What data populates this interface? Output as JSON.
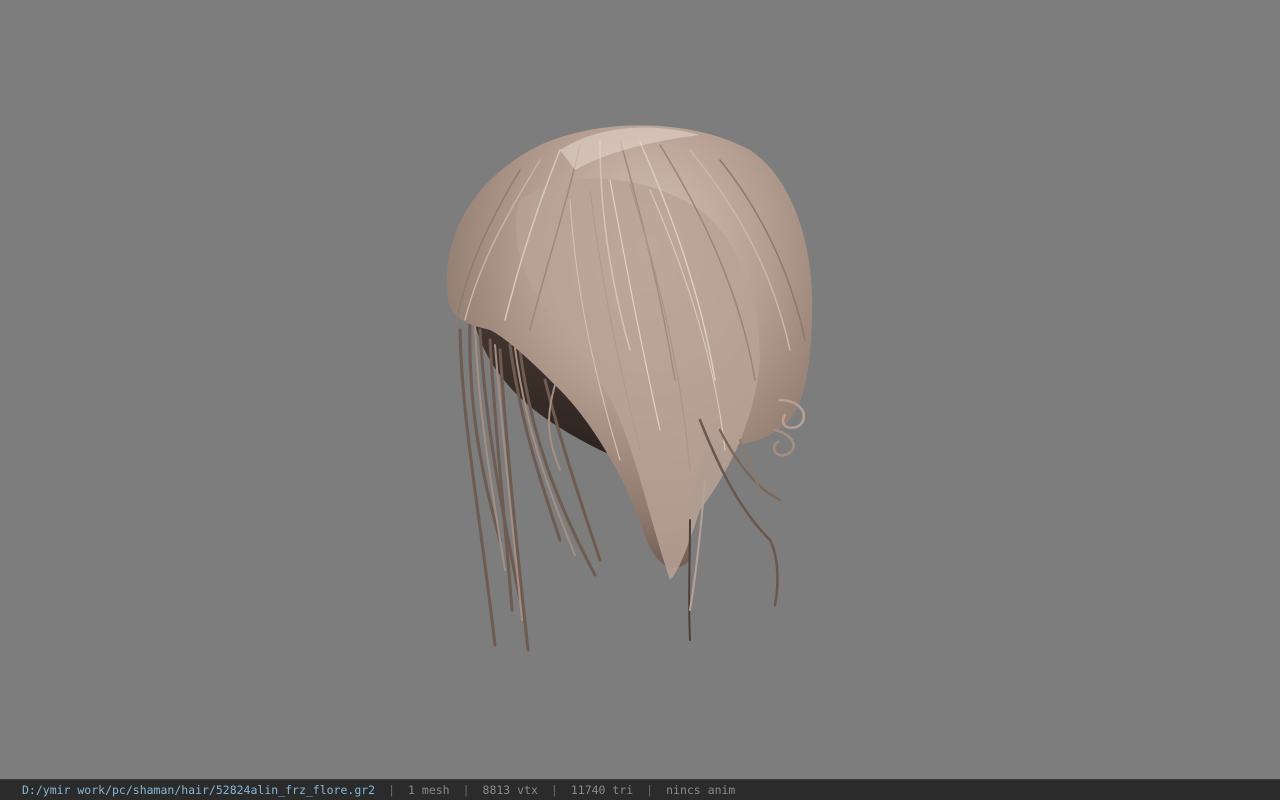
{
  "viewport": {
    "background_color": "#7d7d7d",
    "model": {
      "subject": "hair-mesh",
      "hair_color": "#b59f92"
    }
  },
  "status_bar": {
    "file_path": "D:/ymir work/pc/shaman/hair/52824alin_frz_flore.gr2",
    "separator": "|",
    "mesh_count": "1 mesh",
    "vertex_count": "8813 vtx",
    "triangle_count": "11740 tri",
    "animation": "nincs anim"
  }
}
